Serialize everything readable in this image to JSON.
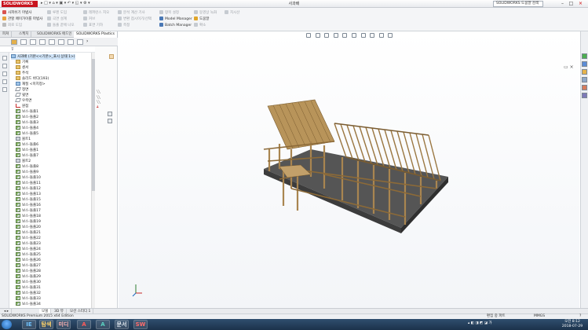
{
  "titlebar": {
    "logo": "SOLIDWORKS",
    "window_title": "사과배",
    "help_search": "SOLIDWORKS 도움말 검색",
    "minimize": "–",
    "maximize": "□",
    "close": "×"
  },
  "command_manager": {
    "col1": [
      "사피쉬기 마법사",
      "관할 페이가이를 마법사",
      "회로 도입"
    ],
    "col2": [
      "루멘 도입",
      "곡면 설계",
      "돌출 끝에 나오"
    ],
    "col3": [
      "레퍼런스 지오",
      "커브",
      "표면 기하"
    ],
    "col4": [
      "분석 계산 기사",
      "변환 점시이기/선택",
      "측정"
    ],
    "col5": [
      "항목 설정",
      "Model Manager",
      "Batch Manager"
    ],
    "col6": [
      "동영상 녹화",
      "도움말",
      "확소"
    ],
    "col7": [
      "치시산"
    ]
  },
  "manager_tabs": [
    "피쳐",
    "스케치",
    "SOLIDWORKS 애드인",
    "SOLIDWORKS Plastics"
  ],
  "feature_tree": [
    {
      "label": "사과배 (기본<<기본>_표시 상태 1>)",
      "icon": "part"
    },
    {
      "label": "기록",
      "icon": "folder"
    },
    {
      "label": "센서",
      "icon": "folder"
    },
    {
      "label": "주석",
      "icon": "folder"
    },
    {
      "label": "솔리드 바디(193)",
      "icon": "folder"
    },
    {
      "label": "재질 <미지정>",
      "icon": "sheet"
    },
    {
      "label": "정면",
      "icon": "plane"
    },
    {
      "label": "윗면",
      "icon": "plane"
    },
    {
      "label": "우측면",
      "icon": "plane"
    },
    {
      "label": "원점",
      "icon": "origin"
    },
    {
      "label": "보스-돌출1",
      "icon": "boss"
    },
    {
      "label": "보스-돌출2",
      "icon": "boss"
    },
    {
      "label": "보스-돌출3",
      "icon": "boss"
    },
    {
      "label": "보스-돌출4",
      "icon": "boss"
    },
    {
      "label": "보스-돌출5",
      "icon": "boss"
    },
    {
      "label": "볼트1",
      "icon": "bolt"
    },
    {
      "label": "보스-돌출6",
      "icon": "boss"
    },
    {
      "label": "보스-돌출1",
      "icon": "boss"
    },
    {
      "label": "보스-돌출7",
      "icon": "boss"
    },
    {
      "label": "볼트2",
      "icon": "bolt"
    },
    {
      "label": "보스-돌출8",
      "icon": "boss"
    },
    {
      "label": "보스-돌출9",
      "icon": "boss"
    },
    {
      "label": "보스-돌출10",
      "icon": "boss"
    },
    {
      "label": "보스-돌출11",
      "icon": "boss"
    },
    {
      "label": "보스-돌출12",
      "icon": "boss"
    },
    {
      "label": "보스-돌출13",
      "icon": "boss"
    },
    {
      "label": "보스-돌출15",
      "icon": "boss"
    },
    {
      "label": "보스-돌출16",
      "icon": "boss"
    },
    {
      "label": "보스-돌출17",
      "icon": "boss"
    },
    {
      "label": "보스-돌출18",
      "icon": "boss"
    },
    {
      "label": "보스-돌출19",
      "icon": "boss"
    },
    {
      "label": "보스-돌출20",
      "icon": "boss"
    },
    {
      "label": "보스-돌출21",
      "icon": "boss"
    },
    {
      "label": "보스-돌출22",
      "icon": "boss"
    },
    {
      "label": "보스-돌출23",
      "icon": "boss"
    },
    {
      "label": "보스-돌출24",
      "icon": "boss"
    },
    {
      "label": "보스-돌출25",
      "icon": "boss"
    },
    {
      "label": "보스-돌출26",
      "icon": "boss"
    },
    {
      "label": "보스-돌출27",
      "icon": "boss"
    },
    {
      "label": "보스-돌출28",
      "icon": "boss"
    },
    {
      "label": "보스-돌출29",
      "icon": "boss"
    },
    {
      "label": "보스-돌출30",
      "icon": "boss"
    },
    {
      "label": "보스-돌출31",
      "icon": "boss"
    },
    {
      "label": "보스-돌출32",
      "icon": "boss"
    },
    {
      "label": "보스-돌출33",
      "icon": "boss"
    },
    {
      "label": "보스-돌출34",
      "icon": "boss"
    }
  ],
  "bottom_tabs": [
    "모델",
    "3D 뷰",
    "모션 스터디 1"
  ],
  "status": {
    "left": "SOLIDWORKS Premium 2015 x64 Edition",
    "mode": "편집 중 파트",
    "units": "MMGS",
    "help": "?"
  },
  "taskbar": {
    "apps": [
      "IE",
      "탐색기",
      "미디어",
      "A",
      "A",
      "문서",
      "SW"
    ],
    "time": "오전 8:12",
    "date": "2018-07-29"
  },
  "colors": {
    "wood": "#b8945a",
    "wood_dark": "#7a5c30",
    "base": "#4f4f4f",
    "sw_red": "#c8141e"
  }
}
